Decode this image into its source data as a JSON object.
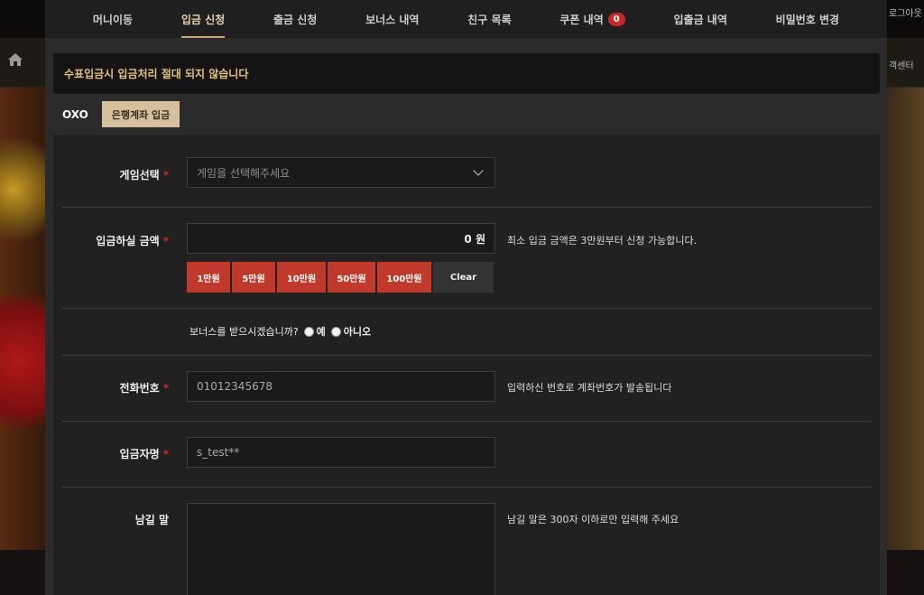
{
  "background": {
    "right_top_text": "로그아웃",
    "right_nav_text": "객센터"
  },
  "tabs": [
    {
      "label": "머니이동"
    },
    {
      "label": "입금 신청",
      "active": true
    },
    {
      "label": "출금 신청"
    },
    {
      "label": "보너스 내역"
    },
    {
      "label": "친구 목록"
    },
    {
      "label": "쿠폰 내역",
      "badge": "0"
    },
    {
      "label": "입출금 내역"
    },
    {
      "label": "비밀번호 변경"
    }
  ],
  "notice": "수표입금시 입금처리 절대 되지 않습니다",
  "methods": {
    "oxo": "OXO",
    "bank": "은행계좌 입금"
  },
  "form": {
    "game": {
      "label": "게임선택",
      "required_mark": "*",
      "placeholder": "게임을 선택해주세요"
    },
    "amount": {
      "label": "입금하실 금액",
      "required_mark": "*",
      "value": "0 원",
      "help": "최소 입금 금액은 3만원부터 신청 가능합니다.",
      "buttons": [
        "1만원",
        "5만원",
        "10만원",
        "50만원",
        "100만원"
      ],
      "clear": "Clear"
    },
    "bonus": {
      "question": "보너스를 받으시겠습니까?",
      "yes": "예",
      "no": "아니오"
    },
    "phone": {
      "label": "전화번호",
      "required_mark": "*",
      "value": "01012345678",
      "help": "입력하신 번호로 계좌번호가 발송됩니다"
    },
    "depositor": {
      "label": "입금자명",
      "required_mark": "*",
      "value": "s_test**"
    },
    "memo": {
      "label": "남길 말",
      "help": "남길 말은 300자 이하로만 입력해 주세요"
    }
  },
  "colors": {
    "accent_gold": "#c6a66b",
    "notice_text": "#e4c27a",
    "amount_button": "#c0392b",
    "required": "#c62828",
    "badge": "#c62828"
  }
}
